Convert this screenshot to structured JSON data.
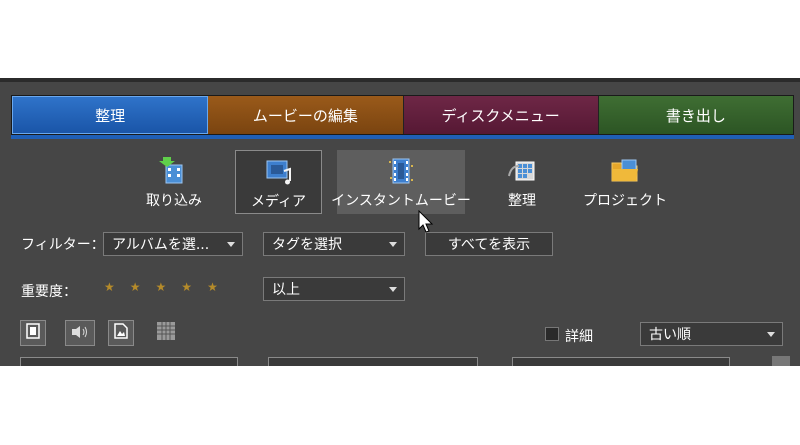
{
  "tabs": [
    {
      "label": "整理",
      "active": true
    },
    {
      "label": "ムービーの編集",
      "active": false
    },
    {
      "label": "ディスクメニュー",
      "active": false
    },
    {
      "label": "書き出し",
      "active": false
    }
  ],
  "toolbar": {
    "items": [
      {
        "label": "取り込み",
        "icon": "import-icon"
      },
      {
        "label": "メディア",
        "icon": "media-icon",
        "selected": true
      },
      {
        "label": "インスタントムービー",
        "icon": "instant-movie-icon",
        "hover": true
      },
      {
        "label": "整理",
        "icon": "organize-icon"
      },
      {
        "label": "プロジェクト",
        "icon": "project-icon"
      }
    ]
  },
  "filter": {
    "label": "フィルター：",
    "album_select": "アルバムを選...",
    "tag_select": "タグを選択",
    "show_all_button": "すべてを表示"
  },
  "rating": {
    "label": "重要度：",
    "stars": 5,
    "compare_select": "以上"
  },
  "view": {
    "detail_label": "詳細",
    "sort_select": "古い順"
  },
  "colors": {
    "tab_organize": "#2f73c9",
    "tab_edit": "#9a5a1a",
    "tab_disc": "#6e2746",
    "tab_export": "#3f6e33",
    "panel_bg": "#464646"
  }
}
